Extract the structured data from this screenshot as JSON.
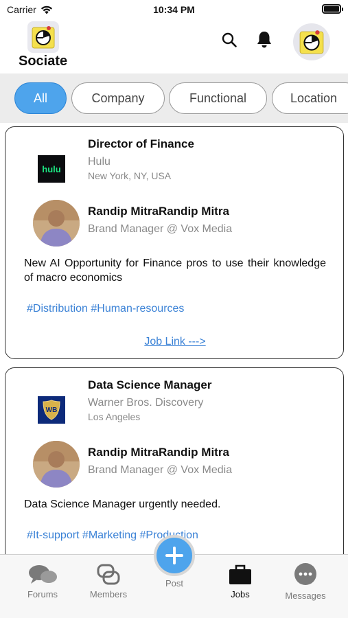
{
  "status_bar": {
    "carrier": "Carrier",
    "time": "10:34 PM"
  },
  "header": {
    "app_name": "Sociate",
    "icons": [
      "search-icon",
      "bell-icon"
    ]
  },
  "filters": [
    {
      "label": "All",
      "active": true
    },
    {
      "label": "Company",
      "active": false
    },
    {
      "label": "Functional",
      "active": false
    },
    {
      "label": "Location",
      "active": false
    }
  ],
  "posts": [
    {
      "job_title": "Director of Finance",
      "company": "Hulu",
      "company_logo_text": "hulu",
      "location": "New York, NY, USA",
      "author_name": "Randip MitraRandip Mitra",
      "author_role": "Brand Manager @ Vox Media",
      "text": "New AI Opportunity for Finance pros to use their knowledge of macro economics",
      "tags": "#Distribution #Human-resources",
      "link_label": "Job Link --->"
    },
    {
      "job_title": "Data Science Manager",
      "company": "Warner Bros. Discovery",
      "company_logo_text": "WB",
      "location": "Los Angeles",
      "author_name": "Randip MitraRandip Mitra",
      "author_role": "Brand Manager @ Vox Media",
      "text": "Data Science Manager urgently needed.",
      "tags": "#It-support #Marketing #Production"
    }
  ],
  "tab_bar": {
    "forums": "Forums",
    "members": "Members",
    "post": "Post",
    "jobs": "Jobs",
    "messages": "Messages",
    "active": "jobs"
  },
  "colors": {
    "accent": "#4ea4ec",
    "link": "#3b82d6",
    "muted": "#8a8a8a"
  }
}
